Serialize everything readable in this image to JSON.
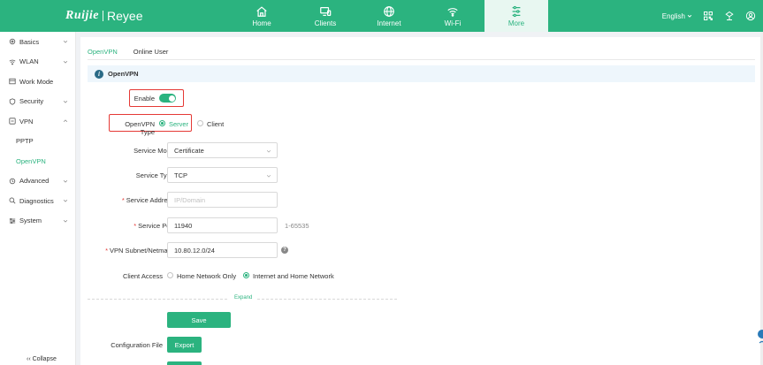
{
  "header": {
    "brand_primary": "Ruijie",
    "brand_secondary": "Reyee",
    "nav": [
      {
        "label": "Home",
        "icon": "home-icon"
      },
      {
        "label": "Clients",
        "icon": "clients-icon"
      },
      {
        "label": "Internet",
        "icon": "globe-icon"
      },
      {
        "label": "Wi-Fi",
        "icon": "wifi-icon"
      },
      {
        "label": "More",
        "icon": "more-sliders-icon",
        "active": true
      }
    ],
    "language": "English",
    "icons": [
      "qr-code-icon",
      "network-tree-icon",
      "user-icon"
    ]
  },
  "sidebar": {
    "items": [
      {
        "label": "Basics",
        "icon": "gear-icon"
      },
      {
        "label": "WLAN",
        "icon": "wifi-icon"
      },
      {
        "label": "Work Mode",
        "icon": "mode-icon"
      },
      {
        "label": "Security",
        "icon": "shield-icon"
      },
      {
        "label": "VPN",
        "icon": "vpn-icon",
        "expanded": true
      },
      {
        "label": "PPTP",
        "sub": true
      },
      {
        "label": "OpenVPN",
        "sub": true,
        "active": true
      },
      {
        "label": "Advanced",
        "icon": "advanced-icon"
      },
      {
        "label": "Diagnostics",
        "icon": "diagnostics-icon"
      },
      {
        "label": "System",
        "icon": "system-icon"
      }
    ],
    "collapse_label": "Collapse"
  },
  "tabs": [
    {
      "label": "OpenVPN",
      "active": true
    },
    {
      "label": "Online User"
    }
  ],
  "section_title": "OpenVPN",
  "form": {
    "enable_label": "Enable",
    "enable_on": true,
    "type_label": "OpenVPN Type",
    "type_options": [
      "Server",
      "Client"
    ],
    "type_selected": "Server",
    "service_mode_label": "Service Mode",
    "service_mode_value": "Certificate",
    "service_type_label": "Service Type",
    "service_type_value": "TCP",
    "service_address_label": "Service Address",
    "service_address_placeholder": "IP/Domain",
    "service_port_label": "Service Port",
    "service_port_value": "11940",
    "service_port_hint": "1-65535",
    "subnet_label": "VPN Subnet/Netmask",
    "subnet_value": "10.80.12.0/24",
    "client_access_label": "Client Access",
    "client_access_options": [
      "Home Network Only",
      "Internet and Home Network"
    ],
    "client_access_selected": "Internet and Home Network",
    "expand_label": "Expand",
    "save_label": "Save",
    "config_file_label": "Configuration File",
    "export_label": "Export"
  },
  "colors": {
    "accent": "#2bb37f",
    "highlight_box": "#e53935",
    "info_banner": "#eef6fc"
  }
}
